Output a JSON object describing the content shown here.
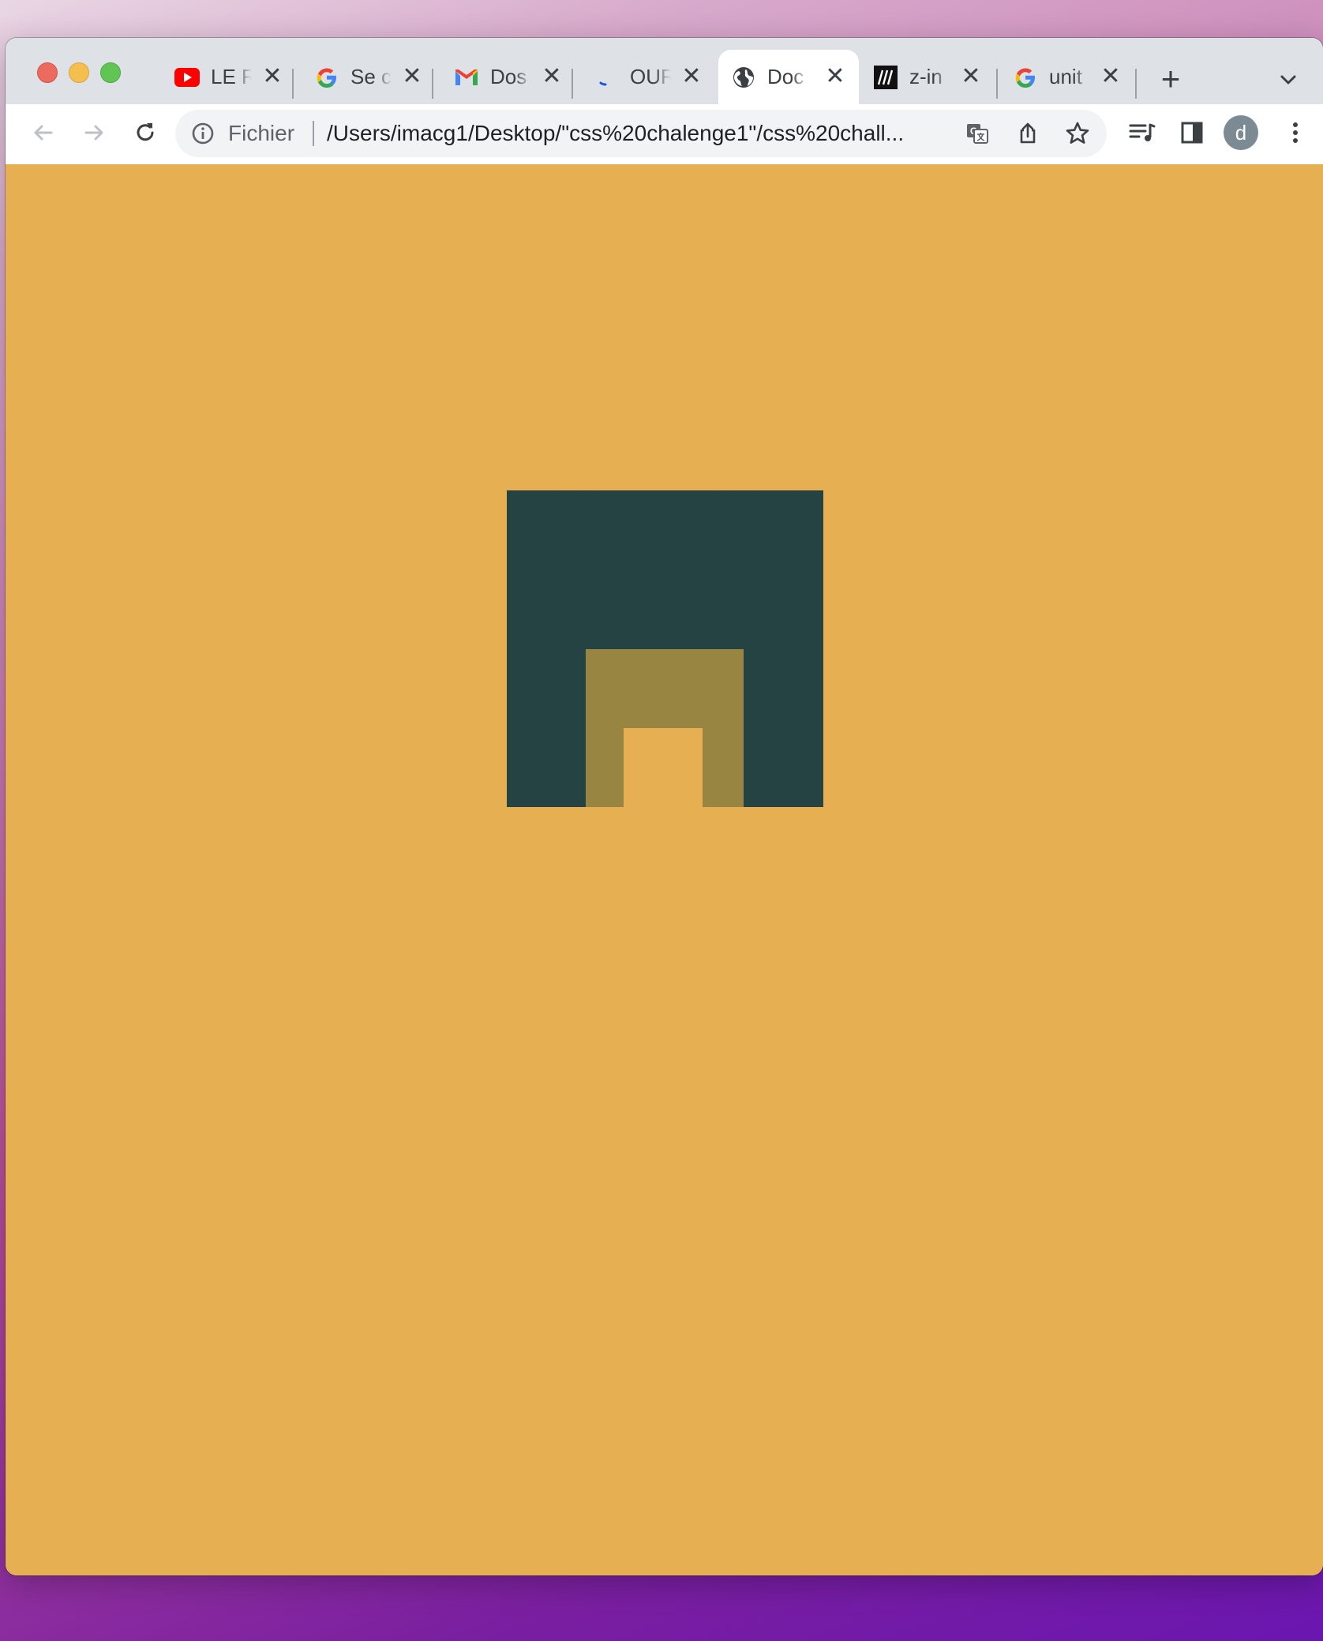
{
  "browser": {
    "tabs": [
      {
        "title": "LE R",
        "icon": "youtube-icon",
        "active": false
      },
      {
        "title": "Se c",
        "icon": "google-icon",
        "active": false
      },
      {
        "title": "Dos",
        "icon": "gmail-icon",
        "active": false
      },
      {
        "title": "OUR",
        "icon": "loading-icon",
        "active": false
      },
      {
        "title": "Doc",
        "icon": "globe-icon",
        "active": true
      },
      {
        "title": "z-in",
        "icon": "mdn-icon",
        "active": false
      },
      {
        "title": "unit",
        "icon": "google-icon",
        "active": false
      }
    ],
    "new_tab_icon": "plus-icon",
    "tab_search_icon": "chevron-down-icon",
    "toolbar": {
      "back_icon": "back-arrow-icon",
      "forward_icon": "forward-arrow-icon",
      "reload_icon": "reload-icon",
      "omnibox": {
        "info_icon": "info-icon",
        "scheme_label": "Fichier",
        "url": "/Users/imacg1/Desktop/\"css%20chalenge1\"/css%20chall...",
        "translate_icon": "translate-icon",
        "share_icon": "share-icon",
        "bookmark_icon": "star-icon"
      },
      "media_icon": "media-control-icon",
      "side_panel_icon": "side-panel-icon",
      "profile_initial": "d",
      "menu_icon": "kebab-menu-icon"
    }
  },
  "page": {
    "background_color": "#e6af51",
    "shapes": [
      {
        "name": "outer-square",
        "color": "#264344"
      },
      {
        "name": "middle-square",
        "color": "#978541"
      },
      {
        "name": "inner-square",
        "color": "#e6af51"
      }
    ]
  }
}
